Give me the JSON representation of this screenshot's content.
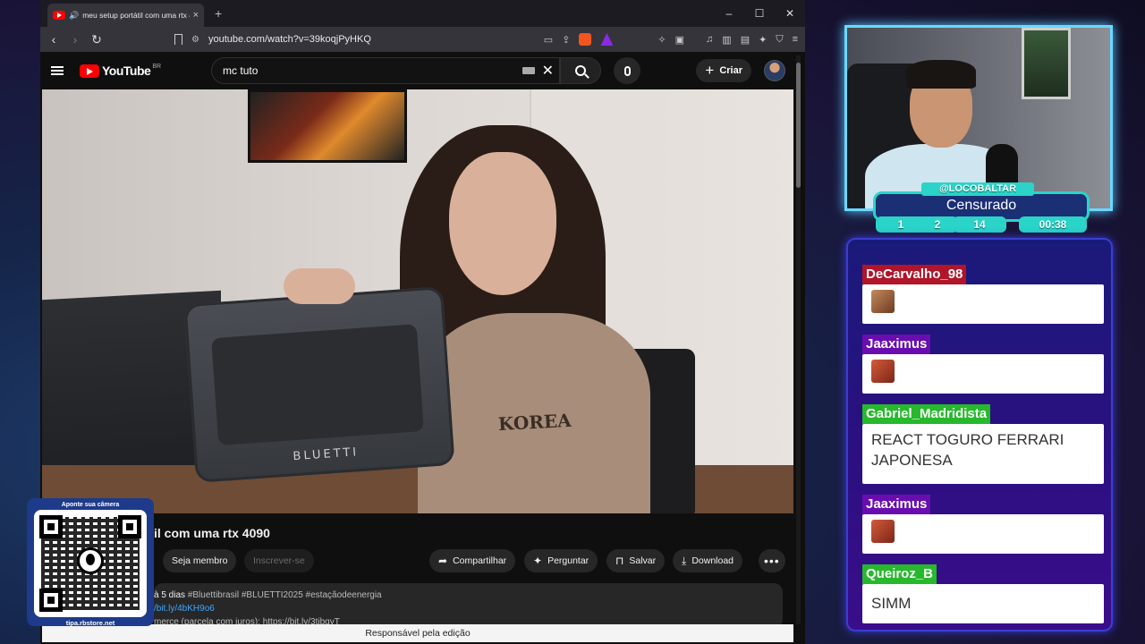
{
  "browser": {
    "tab_title": "meu setup portátil com uma rtx 4090",
    "url": "youtube.com/watch?v=39koqjPyHKQ",
    "window_controls": [
      "–",
      "☐",
      "✕"
    ]
  },
  "youtube": {
    "logo": "YouTube",
    "region": "BR",
    "search_value": "mc tuto",
    "create_label": "Criar",
    "video_title": "il com uma rtx 4090",
    "video_brand_text": "BLUETTI",
    "shirt_text": "KOREA",
    "actions": {
      "member": "Seja membro",
      "subscribe": "Inscrever-se",
      "share": "Compartilhar",
      "ask": "Perguntar",
      "save": "Salvar",
      "download": "Download"
    },
    "description": {
      "age": "à 5 dias",
      "tags": "#Bluettibrasil #BLUETTI2025 #estaçãodeenergia",
      "link": "/bit.ly/4bKH9o6",
      "cut_line": "merce (parcela com juros): https://bit.ly/3tjbgyT"
    },
    "status_text": "Responsável pela edição"
  },
  "qr": {
    "top_text": "Aponte sua câmera",
    "url": "tipa.rbstore.net"
  },
  "stream": {
    "handle": "@LOCOBALTAR",
    "status": "Censurado",
    "stats": [
      "1",
      "2",
      "14",
      "00:38"
    ]
  },
  "chat": {
    "messages": [
      {
        "user": "DeCarvalho_98",
        "user_color": "#b0152a",
        "text": "",
        "emote": true
      },
      {
        "user": "Jaaximus",
        "user_color": "#6a0db0",
        "text": "",
        "emote": true
      },
      {
        "user": "Gabriel_Madridista",
        "user_color": "#27b82c",
        "text": "REACT TOGURO FERRARI JAPONESA",
        "emote": false
      },
      {
        "user": "Jaaximus",
        "user_color": "#6a0db0",
        "text": "",
        "emote": true
      },
      {
        "user": "Queiroz_B",
        "user_color": "#27b82c",
        "text": "SIMM",
        "emote": false
      }
    ]
  },
  "icons": {
    "back": "arrow-left-icon",
    "forward": "arrow-right-icon",
    "reload": "reload-icon",
    "search": "search-icon",
    "mic": "mic-icon",
    "share": "share-icon",
    "ask": "sparkle-icon",
    "save": "bookmark-icon",
    "download": "download-icon"
  }
}
